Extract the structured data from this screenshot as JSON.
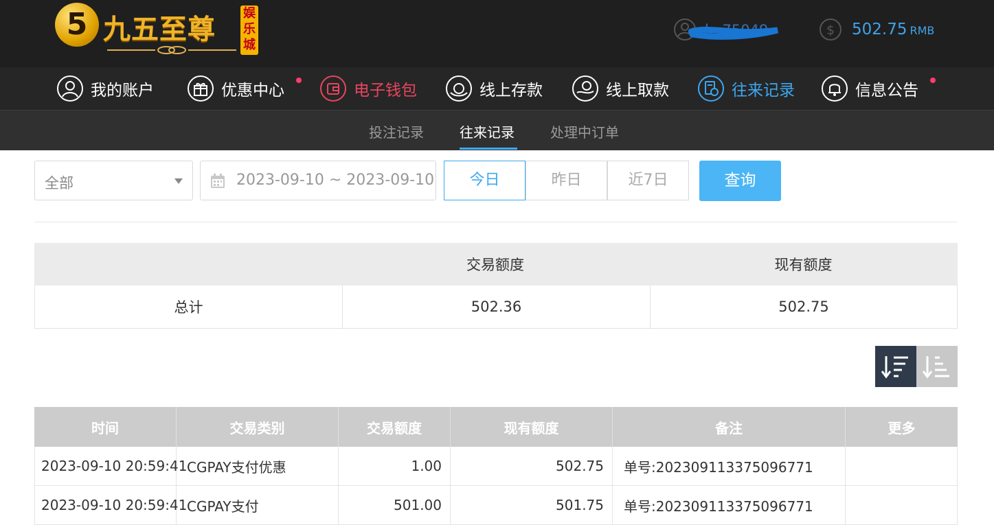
{
  "header": {
    "logo_digit": "5",
    "logo_name": "九五至尊",
    "logo_seal": "娱乐城",
    "username": "k··75049",
    "balance": "502.75",
    "balance_unit": "RMB"
  },
  "nav": [
    {
      "label": "我的账户",
      "icon": "user-icon",
      "badge": false
    },
    {
      "label": "优惠中心",
      "icon": "gift-icon",
      "badge": true
    },
    {
      "label": "电子钱包",
      "icon": "wallet-icon",
      "badge": false
    },
    {
      "label": "线上存款",
      "icon": "deposit-icon",
      "badge": false
    },
    {
      "label": "线上取款",
      "icon": "withdraw-icon",
      "badge": false
    },
    {
      "label": "往来记录",
      "icon": "records-icon",
      "badge": false
    },
    {
      "label": "信息公告",
      "icon": "bell-icon",
      "badge": true
    }
  ],
  "subnav": [
    "投注记录",
    "往来记录",
    "处理中订单"
  ],
  "filters": {
    "type_select": "全部",
    "date_range": "2023-09-10 ~ 2023-09-10",
    "quick": [
      "今日",
      "昨日",
      "近7日"
    ],
    "search": "查询"
  },
  "summary": {
    "headers": [
      "",
      "交易额度",
      "现有额度"
    ],
    "row": [
      "总计",
      "502.36",
      "502.75"
    ]
  },
  "table": {
    "headers": [
      "时间",
      "交易类别",
      "交易额度",
      "现有额度",
      "备注",
      "更多"
    ],
    "rows": [
      [
        "2023-09-10 20:59:41",
        "CGPAY支付优惠",
        "1.00",
        "502.75",
        "单号:202309113375096771",
        ""
      ],
      [
        "2023-09-10 20:59:41",
        "CGPAY支付",
        "501.00",
        "501.75",
        "单号:202309113375096771",
        ""
      ]
    ]
  },
  "colors": {
    "accent_blue": "#3da8f0",
    "wallet_red": "#e8455f",
    "header_bg": "#1f1f1f",
    "search_btn": "#4bb5f5"
  }
}
